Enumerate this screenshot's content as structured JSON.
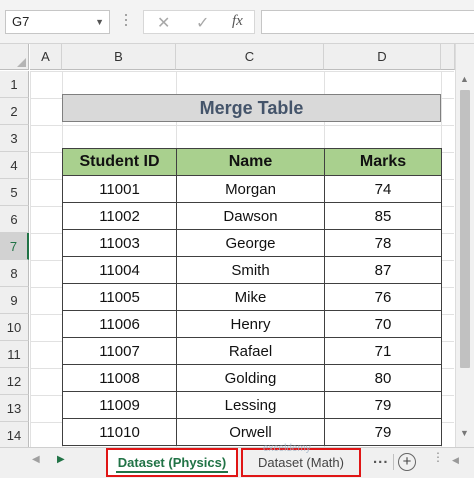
{
  "formula_bar": {
    "name_box": "G7",
    "cancel_icon": "✕",
    "enter_icon": "✓",
    "function_icon": "fx",
    "formula": ""
  },
  "columns": [
    "A",
    "B",
    "C",
    "D"
  ],
  "rows": [
    "1",
    "2",
    "3",
    "4",
    "5",
    "6",
    "7",
    "8",
    "9",
    "10",
    "11",
    "12",
    "13",
    "14"
  ],
  "selected_row": "7",
  "merge_title": "Merge Table",
  "table": {
    "headers": [
      "Student ID",
      "Name",
      "Marks"
    ],
    "rows": [
      [
        "11001",
        "Morgan",
        "74"
      ],
      [
        "11002",
        "Dawson",
        "85"
      ],
      [
        "11003",
        "George",
        "78"
      ],
      [
        "11004",
        "Smith",
        "87"
      ],
      [
        "11005",
        "Mike",
        "76"
      ],
      [
        "11006",
        "Henry",
        "70"
      ],
      [
        "11007",
        "Rafael",
        "71"
      ],
      [
        "11008",
        "Golding",
        "80"
      ],
      [
        "11009",
        "Lessing",
        "79"
      ],
      [
        "11010",
        "Orwell",
        "79"
      ]
    ]
  },
  "sheet_tabs": {
    "active": "Dataset (Physics)",
    "other": "Dataset (Math)",
    "more": "...",
    "add": "+"
  },
  "watermark": "exceldemy",
  "colors": {
    "header_fill": "#a9d08e",
    "title_fill": "#d9d9d9",
    "title_text": "#44546a",
    "excel_green": "#217346",
    "tab_highlight": "#e01515"
  }
}
